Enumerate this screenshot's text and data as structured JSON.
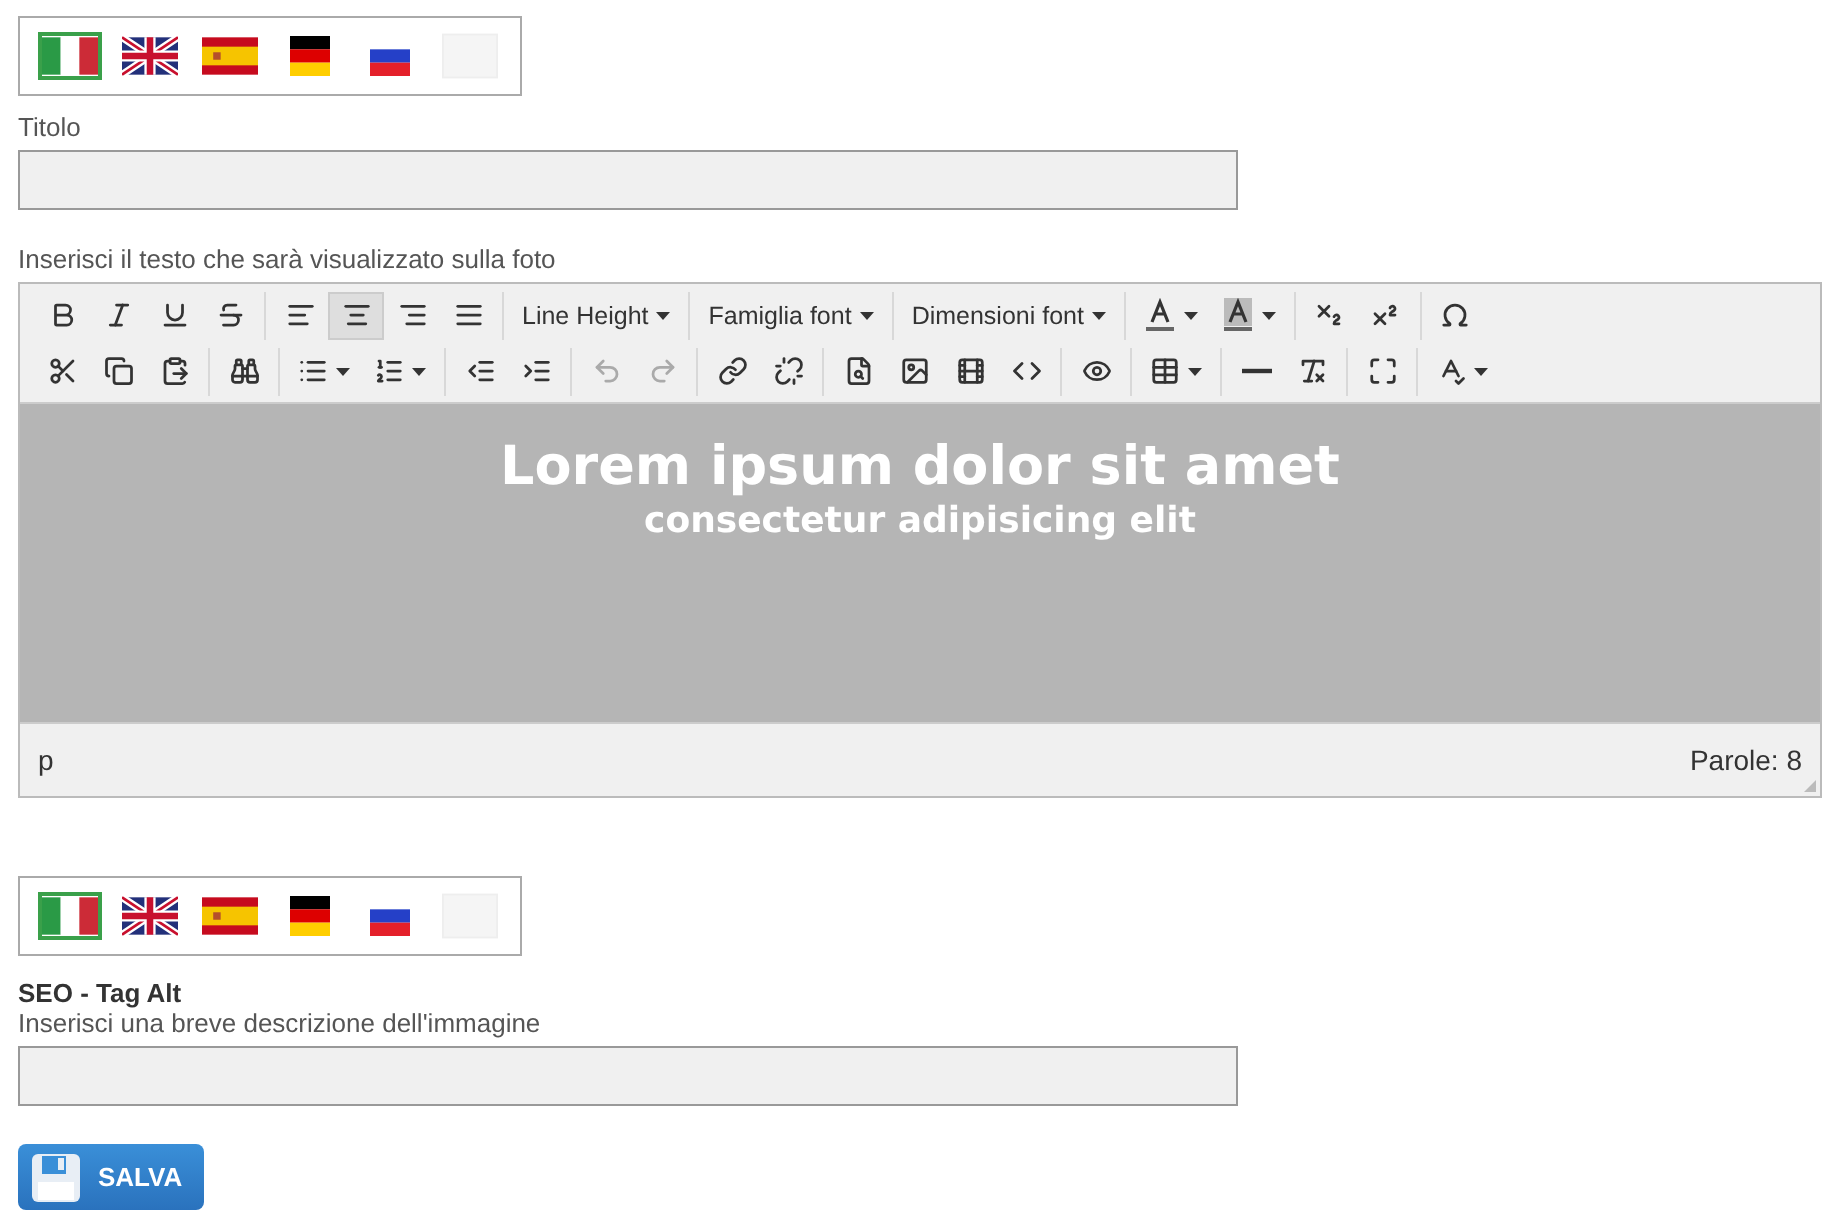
{
  "title_section": {
    "languages": [
      {
        "kind": "it",
        "selected": true
      },
      {
        "kind": "gb",
        "selected": false
      },
      {
        "kind": "es",
        "selected": false
      },
      {
        "kind": "de",
        "selected": false
      },
      {
        "kind": "ru",
        "selected": false
      },
      {
        "kind": "empty",
        "selected": false
      }
    ],
    "label": "Titolo"
  },
  "editor_label": "Inserisci il testo che sarà visualizzato sulla foto",
  "toolbar_rows": [
    [
      [
        {
          "kind": "bold",
          "selected": false,
          "disabled": false
        },
        {
          "kind": "italic",
          "selected": false,
          "disabled": false
        },
        {
          "kind": "underline",
          "selected": false,
          "disabled": false
        },
        {
          "kind": "strikethrough",
          "selected": false,
          "disabled": false
        }
      ],
      [
        {
          "kind": "alignleft",
          "selected": false,
          "disabled": false
        },
        {
          "kind": "aligncenter",
          "selected": true,
          "disabled": false
        },
        {
          "kind": "alignright",
          "selected": false,
          "disabled": false
        },
        {
          "kind": "alignjustify",
          "selected": false,
          "disabled": false
        }
      ],
      [
        {
          "kind": "menu",
          "label": "Line Height",
          "selected": false,
          "disabled": false
        }
      ],
      [
        {
          "kind": "menu",
          "label": "Famiglia font",
          "selected": false,
          "disabled": false
        }
      ],
      [
        {
          "kind": "menu",
          "label": "Dimensioni font",
          "selected": false,
          "disabled": false
        }
      ],
      [
        {
          "kind": "forecolor",
          "selected": false,
          "disabled": false
        },
        {
          "kind": "backcolor",
          "selected": false,
          "disabled": false
        }
      ],
      [
        {
          "kind": "subscript",
          "selected": false,
          "disabled": false
        },
        {
          "kind": "superscript",
          "selected": false,
          "disabled": false
        }
      ],
      [
        {
          "kind": "charmap",
          "selected": false,
          "disabled": false
        }
      ]
    ],
    [
      [
        {
          "kind": "cut",
          "selected": false,
          "disabled": false
        },
        {
          "kind": "copy",
          "selected": false,
          "disabled": false
        },
        {
          "kind": "paste",
          "selected": false,
          "disabled": false
        }
      ],
      [
        {
          "kind": "searchreplace",
          "selected": false,
          "disabled": false
        }
      ],
      [
        {
          "kind": "bullist",
          "selected": false,
          "disabled": false
        },
        {
          "kind": "numlist",
          "selected": false,
          "disabled": false
        }
      ],
      [
        {
          "kind": "outdent",
          "selected": false,
          "disabled": false
        },
        {
          "kind": "indent",
          "selected": false,
          "disabled": false
        }
      ],
      [
        {
          "kind": "undo",
          "selected": false,
          "disabled": true
        },
        {
          "kind": "redo",
          "selected": false,
          "disabled": true
        }
      ],
      [
        {
          "kind": "link",
          "selected": false,
          "disabled": false
        },
        {
          "kind": "unlink",
          "selected": false,
          "disabled": false
        }
      ],
      [
        {
          "kind": "filesearch",
          "selected": false,
          "disabled": false
        },
        {
          "kind": "image",
          "selected": false,
          "disabled": false
        },
        {
          "kind": "media",
          "selected": false,
          "disabled": false
        },
        {
          "kind": "code",
          "selected": false,
          "disabled": false
        }
      ],
      [
        {
          "kind": "preview",
          "selected": false,
          "disabled": false
        }
      ],
      [
        {
          "kind": "table",
          "selected": false,
          "disabled": false
        }
      ],
      [
        {
          "kind": "hr",
          "selected": false,
          "disabled": false
        },
        {
          "kind": "removeformat",
          "selected": false,
          "disabled": false
        }
      ],
      [
        {
          "kind": "fullscreen",
          "selected": false,
          "disabled": false
        }
      ],
      [
        {
          "kind": "spellcheck",
          "selected": false,
          "disabled": false
        }
      ]
    ]
  ],
  "content": {
    "heading": "Lorem ipsum dolor sit amet",
    "subheading": "consectetur adipisicing elit"
  },
  "status_bar": {
    "path": "p",
    "word_count": "Parole: 8"
  },
  "seo_section": {
    "languages": [
      {
        "kind": "it",
        "selected": true
      },
      {
        "kind": "gb",
        "selected": false
      },
      {
        "kind": "es",
        "selected": false
      },
      {
        "kind": "de",
        "selected": false
      },
      {
        "kind": "ru",
        "selected": false
      },
      {
        "kind": "empty",
        "selected": false
      }
    ],
    "label": "SEO - Tag Alt",
    "hint": "Inserisci una breve descrizione dell'immagine"
  },
  "save_button": "SALVA"
}
